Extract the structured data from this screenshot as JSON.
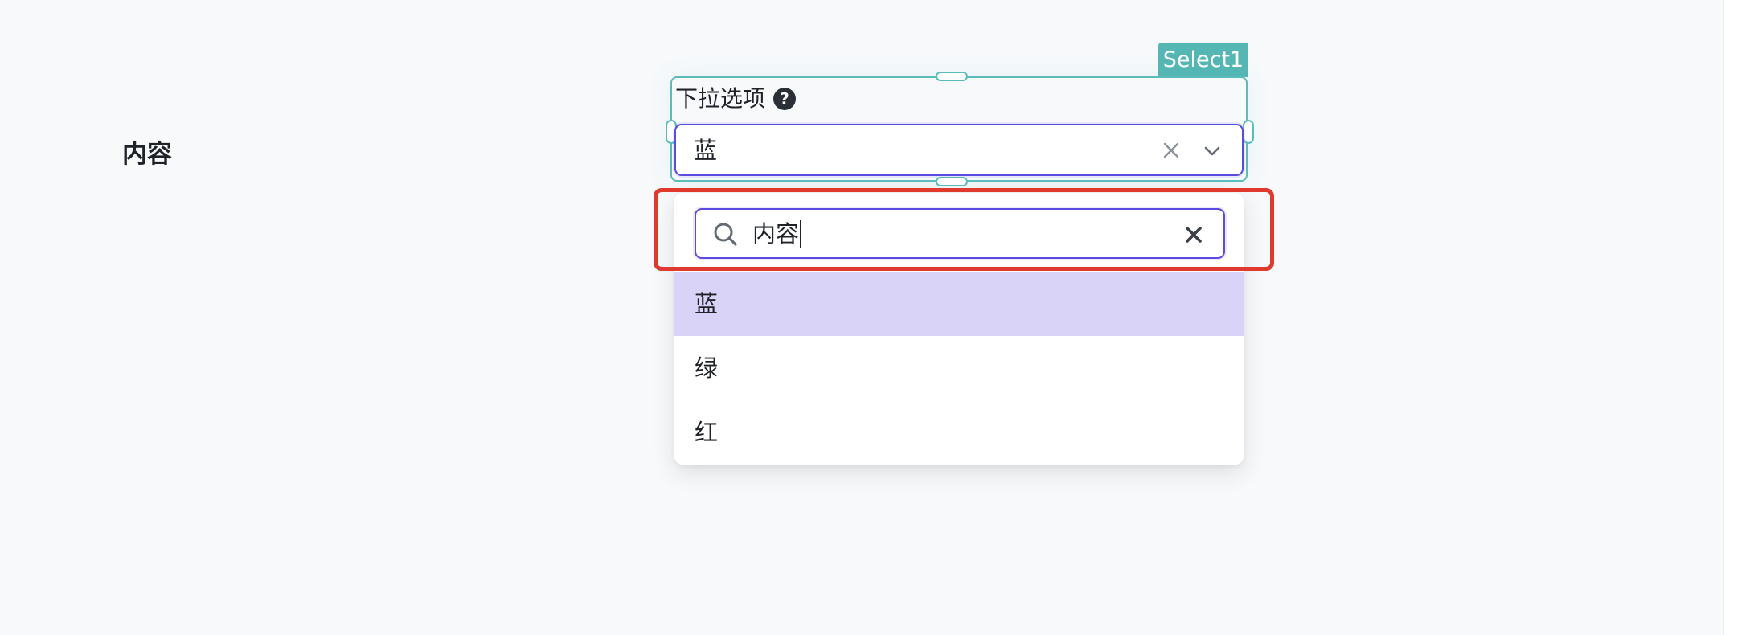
{
  "page": {
    "side_label": "内容"
  },
  "component": {
    "tag": "Select1",
    "label": "下拉选项",
    "help_icon": "question-circle-icon",
    "selected_value": "蓝",
    "clear_icon": "close-icon",
    "arrow_icon": "chevron-down-icon"
  },
  "dropdown": {
    "search": {
      "icon": "search-icon",
      "value": "内容",
      "clear_icon": "close-bold-icon"
    },
    "options": [
      {
        "label": "蓝",
        "active": true
      },
      {
        "label": "绿",
        "active": false
      },
      {
        "label": "红",
        "active": false
      }
    ]
  },
  "colors": {
    "accent": "#5b4cde",
    "selection_frame": "#5bbcbc",
    "active_option_bg": "#d9d3f7",
    "annotation": "#e03a2f"
  }
}
